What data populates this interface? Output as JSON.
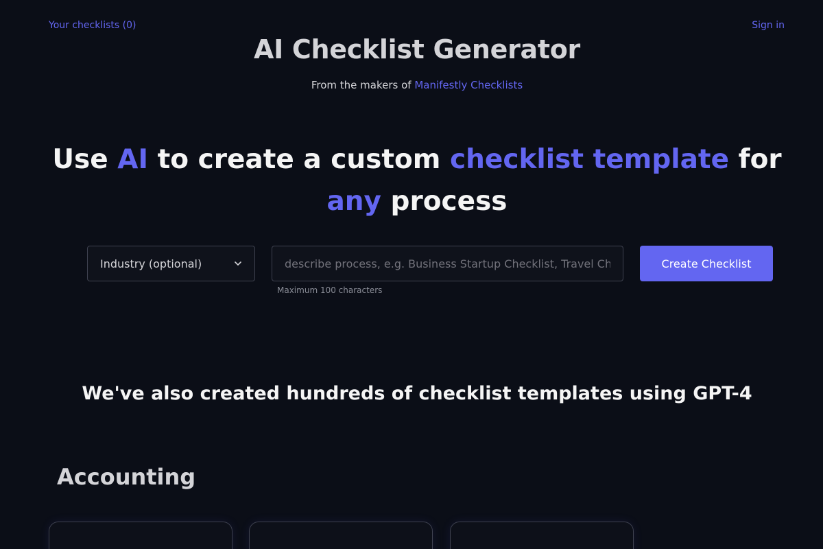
{
  "nav": {
    "checklists_link": "Your checklists (0)",
    "signin_link": "Sign in"
  },
  "header": {
    "title": "AI Checklist Generator",
    "makers_prefix": "From the makers of ",
    "makers_link": "Manifestly Checklists"
  },
  "hero": {
    "part1": "Use ",
    "accent1": "AI",
    "part2": " to create a custom ",
    "accent2": "checklist template",
    "part3": " for ",
    "accent3": "any",
    "part4": " process"
  },
  "form": {
    "industry_label": "Industry (optional)",
    "process_placeholder": "describe process, e.g. Business Startup Checklist, Travel Checklist",
    "process_value": "",
    "hint": "Maximum 100 characters",
    "create_label": "Create Checklist"
  },
  "templates": {
    "heading": "We've also created hundreds of checklist templates using GPT-4",
    "category": "Accounting"
  },
  "colors": {
    "background": "#0b0e17",
    "accent": "#6366f1",
    "text": "#f5f5f5",
    "muted": "#8a8d97"
  },
  "icons": {
    "industry_dropdown": "chevron-down-icon"
  }
}
